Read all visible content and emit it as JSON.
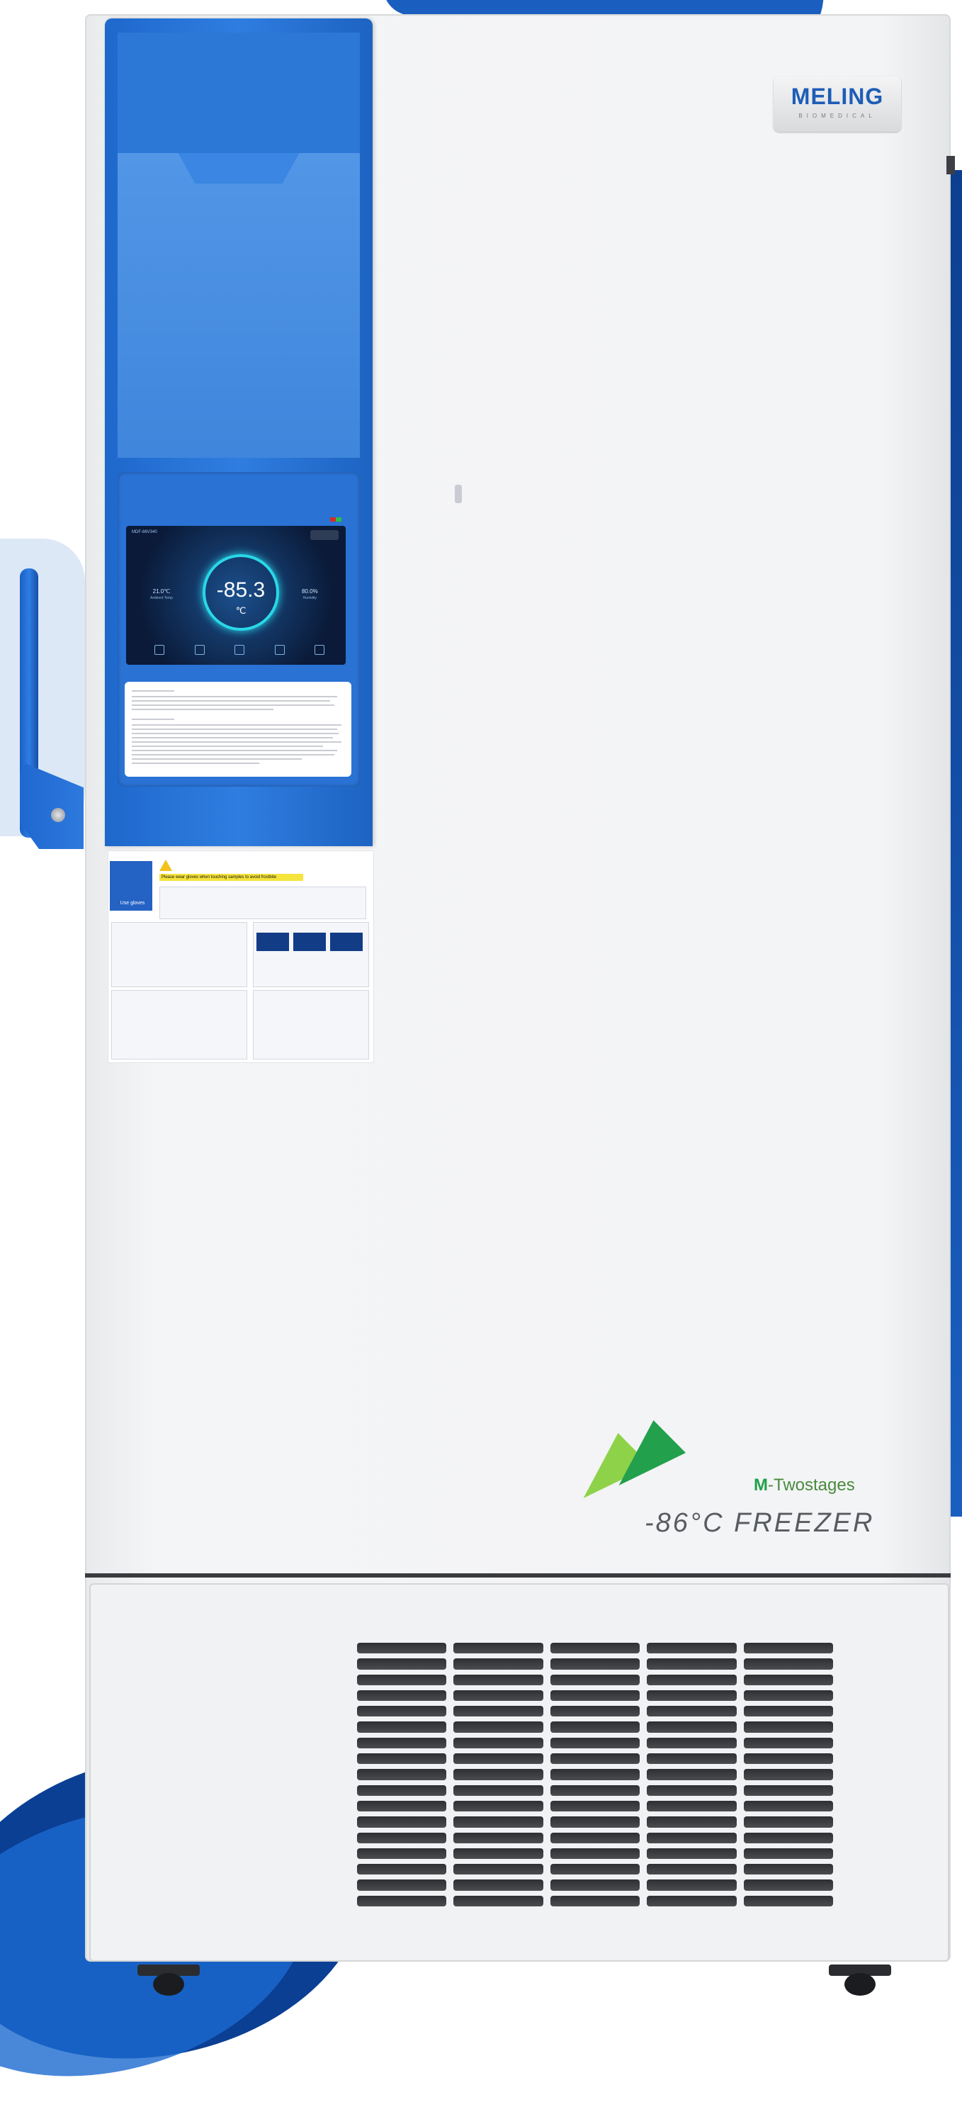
{
  "brand": {
    "logo_word": "MELING",
    "logo_sub": "BIOMEDICAL"
  },
  "display": {
    "main_temp": "-85.3",
    "main_unit": "℃",
    "left_temp": "21.0℃",
    "left_label": "Ambient Temp",
    "right_temp": "80.0%",
    "right_label": "Humidity",
    "header": "MDF-86V340"
  },
  "sticker": {
    "glove_caption": "Use gloves",
    "warning": "Please wear gloves when touching samples to avoid frostbite"
  },
  "product_mark": {
    "m_letter": "M",
    "series_name": "-Twostages",
    "freezer_text": "-86°C FREEZER"
  },
  "colors": {
    "panel_blue": "#2f7de0",
    "brand_blue": "#1e5db6",
    "arrow_light_green": "#8ed24a",
    "arrow_dark_green": "#22a04b",
    "display_ring": "#29d8e8"
  }
}
